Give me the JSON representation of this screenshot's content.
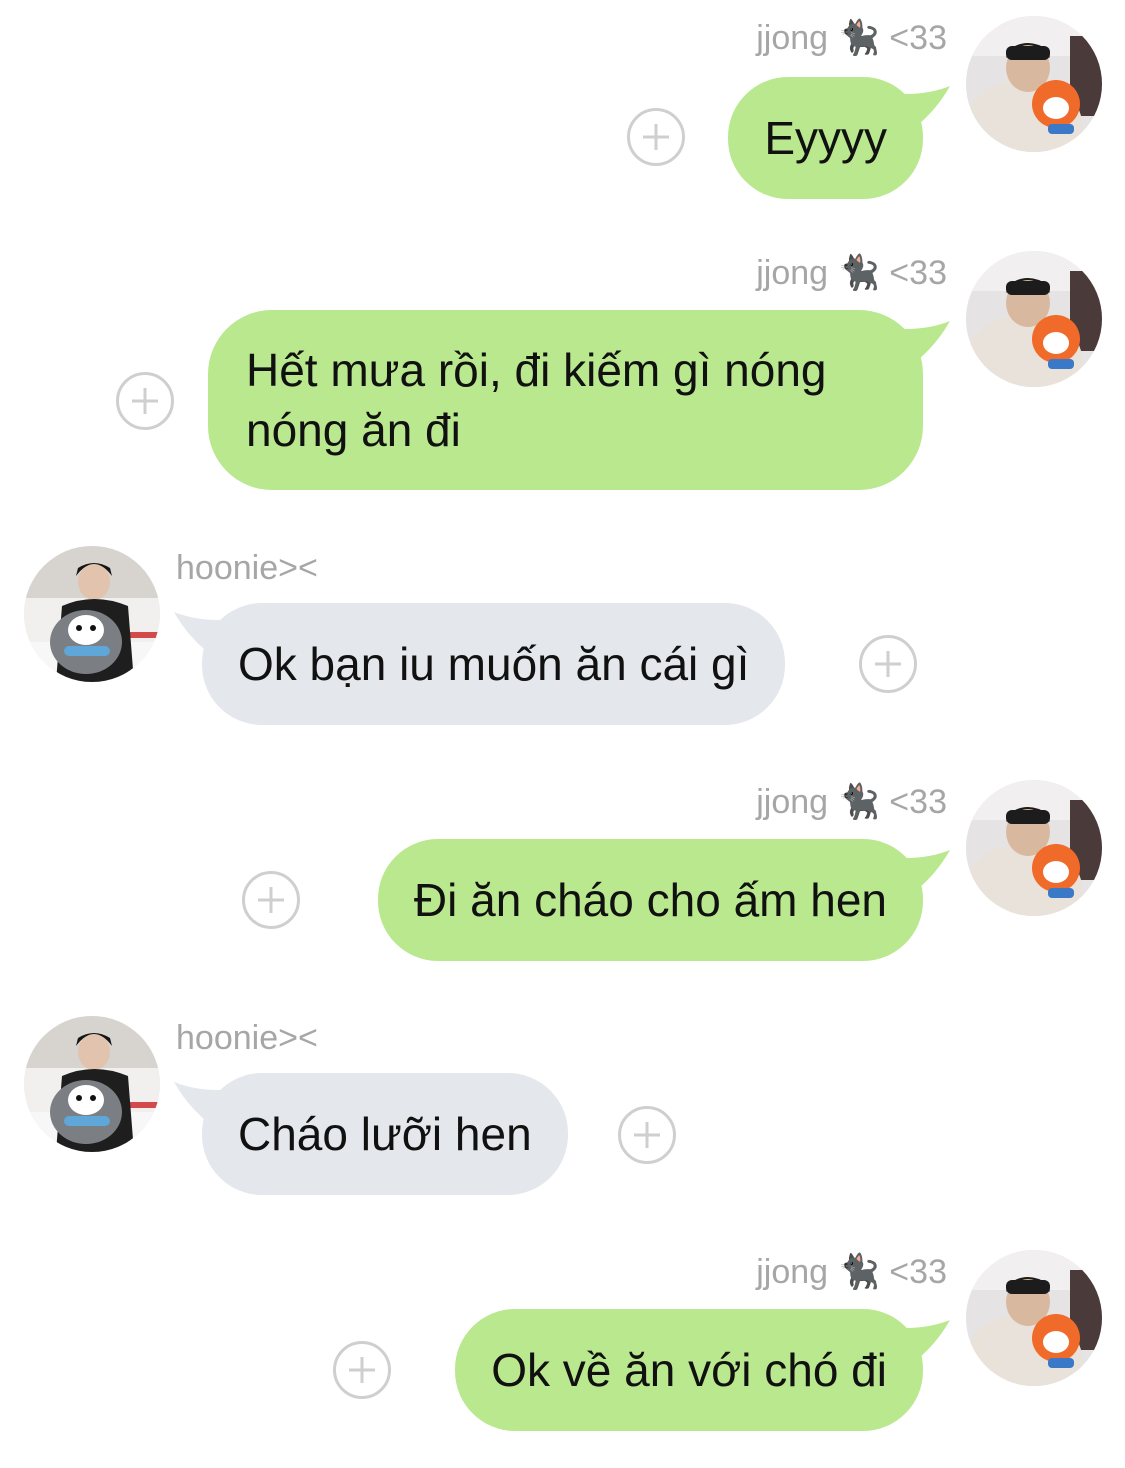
{
  "colors": {
    "outgoing_bubble": "#b9e88e",
    "incoming_bubble": "#e4e7eb",
    "name_text": "#a6a6a6",
    "add_icon": "#cfcfcf"
  },
  "messages": [
    {
      "sender": "jjong 🐈‍⬛ <33",
      "direction": "outgoing",
      "text": "Eyyyy",
      "action_icon": "add-reaction-icon"
    },
    {
      "sender": "jjong 🐈‍⬛ <33",
      "direction": "outgoing",
      "text": "Hết mưa rồi, đi kiếm gì nóng nóng ăn đi",
      "action_icon": "add-reaction-icon"
    },
    {
      "sender": "hoonie><",
      "direction": "incoming",
      "text": "Ok bạn iu muốn ăn cái gì",
      "action_icon": "add-reaction-icon"
    },
    {
      "sender": "jjong 🐈‍⬛ <33",
      "direction": "outgoing",
      "text": "Đi ăn cháo cho ấm hen",
      "action_icon": "add-reaction-icon"
    },
    {
      "sender": "hoonie><",
      "direction": "incoming",
      "text": "Cháo lưỡi hen",
      "action_icon": "add-reaction-icon"
    },
    {
      "sender": "jjong 🐈‍⬛ <33",
      "direction": "outgoing",
      "text": "Ok về ăn với chó đi",
      "action_icon": "add-reaction-icon"
    }
  ]
}
